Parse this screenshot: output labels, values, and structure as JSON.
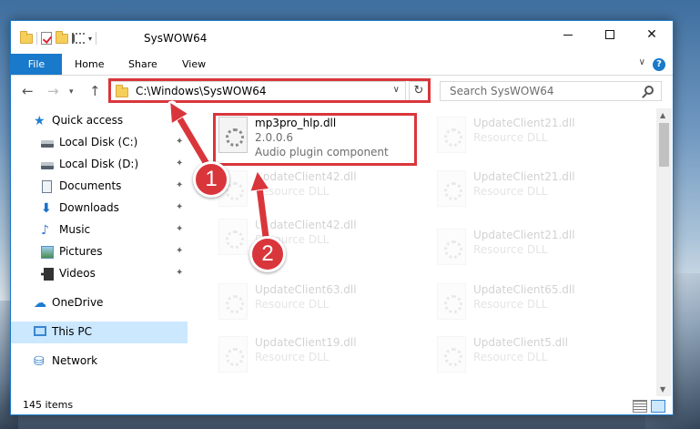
{
  "window": {
    "title": "SysWOW64",
    "controls": {
      "minimize": "",
      "maximize": "",
      "close": "✕"
    }
  },
  "ribbon": {
    "tabs": [
      "File",
      "Home",
      "Share",
      "View"
    ],
    "help": "?"
  },
  "nav": {
    "back": "←",
    "forward": "→",
    "up": "↑",
    "address": "C:\\Windows\\SysWOW64",
    "refresh": "↻",
    "search_placeholder": "Search SysWOW64"
  },
  "sidebar": {
    "items": [
      {
        "label": "Quick access",
        "icon": "star-icon",
        "pinned": false
      },
      {
        "label": "Local Disk (C:)",
        "icon": "disk-icon",
        "pinned": true
      },
      {
        "label": "Local Disk (D:)",
        "icon": "disk-icon",
        "pinned": true
      },
      {
        "label": "Documents",
        "icon": "documents-icon",
        "pinned": true
      },
      {
        "label": "Downloads",
        "icon": "download-icon",
        "pinned": true
      },
      {
        "label": "Music",
        "icon": "music-icon",
        "pinned": true
      },
      {
        "label": "Pictures",
        "icon": "pictures-icon",
        "pinned": true
      },
      {
        "label": "Videos",
        "icon": "videos-icon",
        "pinned": true
      },
      {
        "label": "OneDrive",
        "icon": "onedrive-icon",
        "pinned": false
      },
      {
        "label": "This PC",
        "icon": "pc-icon",
        "pinned": false,
        "selected": true
      },
      {
        "label": "Network",
        "icon": "network-icon",
        "pinned": false
      }
    ],
    "pin_glyph": "📌"
  },
  "files": {
    "highlighted": {
      "name": "mp3pro_hlp.dll",
      "version": "2.0.0.6",
      "description": "Audio plugin component"
    },
    "col1": [
      {
        "name": "UpdateClient42.dll",
        "type": "Resource DLL"
      },
      {
        "name": "UpdateClient42.dll",
        "type": "Resource DLL"
      },
      {
        "name": "UpdateClient63.dll",
        "type": "Resource DLL"
      },
      {
        "name": "UpdateClient19.dll",
        "type": "Resource DLL"
      }
    ],
    "col2": [
      {
        "name": "UpdateClient21.dll",
        "type": "Resource DLL"
      },
      {
        "name": "UpdateClient21.dll",
        "type": "Resource DLL"
      },
      {
        "name": "UpdateClient21.dll",
        "type": "Resource DLL"
      },
      {
        "name": "UpdateClient65.dll",
        "type": "Resource DLL"
      },
      {
        "name": "UpdateClient5.dll",
        "type": "Resource DLL"
      }
    ]
  },
  "status": {
    "items": "145 items"
  },
  "annotations": {
    "step1": "1",
    "step2": "2",
    "color": "#d9363b"
  }
}
